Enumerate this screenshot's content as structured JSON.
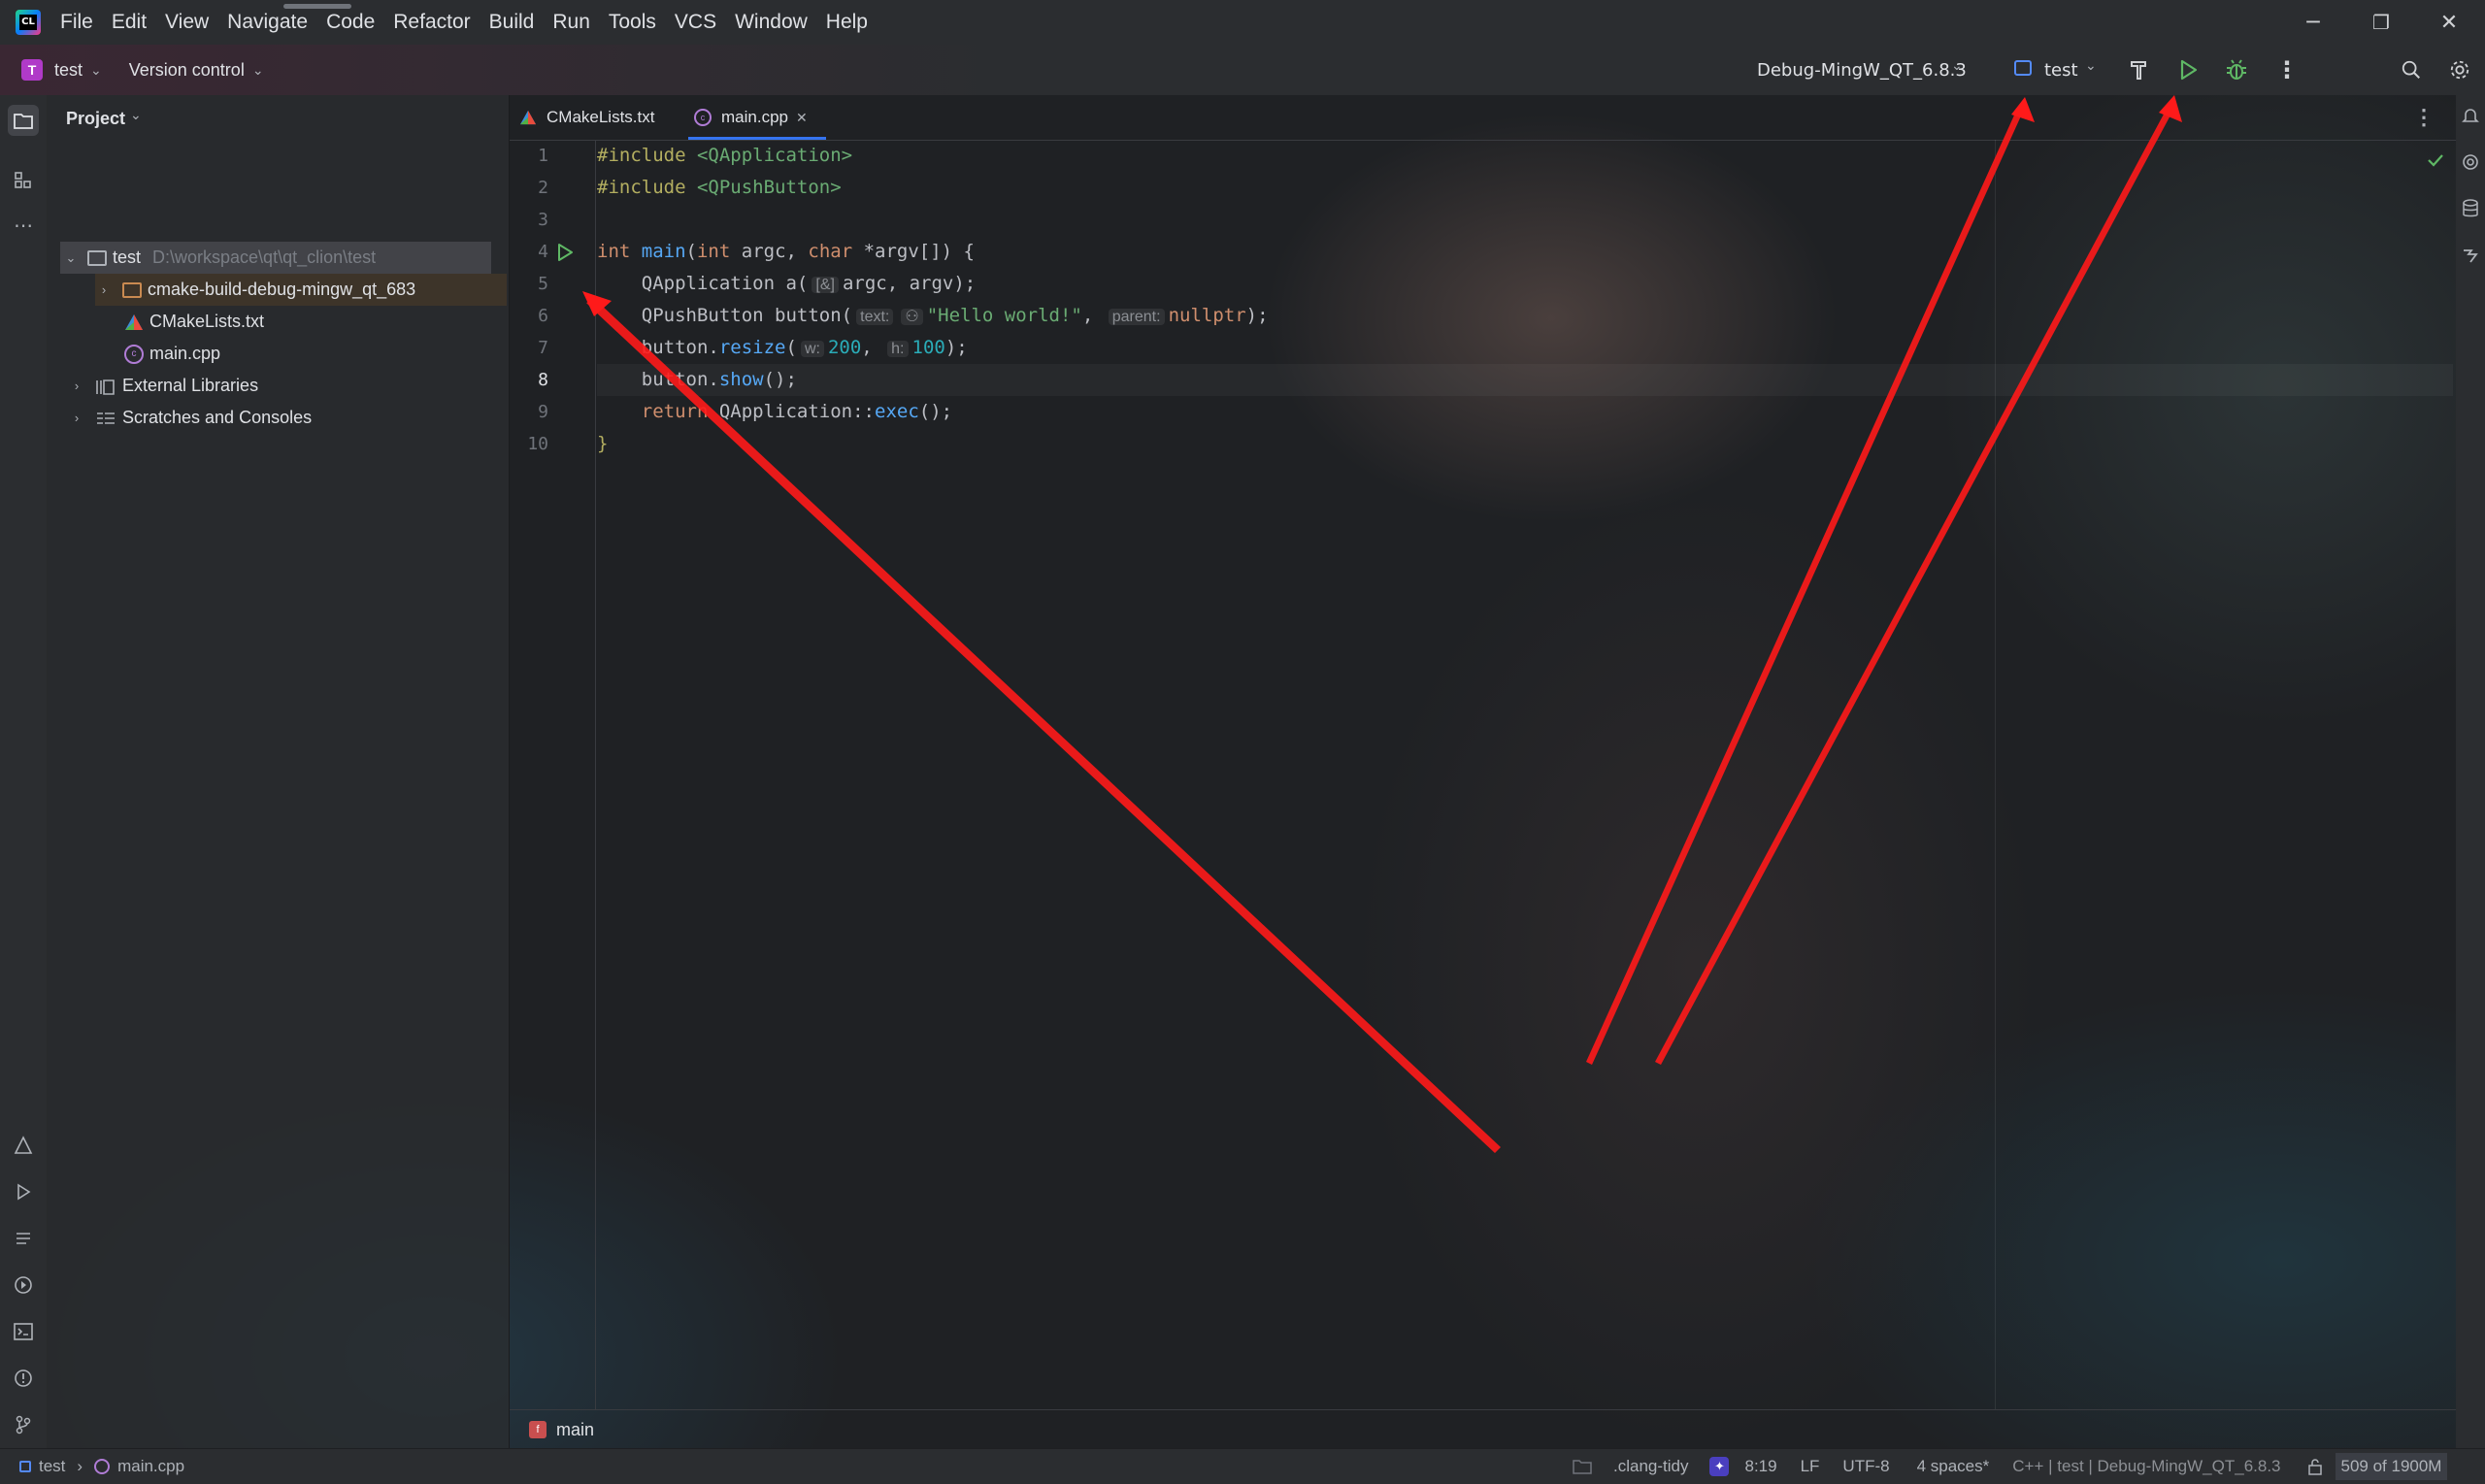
{
  "menubar": {
    "items": [
      "File",
      "Edit",
      "View",
      "Navigate",
      "Code",
      "Refactor",
      "Build",
      "Run",
      "Tools",
      "VCS",
      "Window",
      "Help"
    ]
  },
  "window_controls": {
    "minimize": "─",
    "restore": "❐",
    "close": "✕"
  },
  "toolbar": {
    "project_badge": "T",
    "project_name": "test",
    "vcs_label": "Version control",
    "build_config": "Debug-MingW_QT_6.8.3",
    "run_config": "test",
    "build_icon": "hammer-icon",
    "run_icon": "run-icon",
    "debug_icon": "debug-icon",
    "more_icon": "more-icon",
    "search_icon": "search-icon",
    "settings_icon": "gear-icon"
  },
  "project_panel": {
    "title": "Project",
    "root": {
      "name": "test",
      "path": "D:\\workspace\\qt\\qt_clion\\test"
    },
    "items": [
      {
        "name": "cmake-build-debug-mingw_qt_683"
      },
      {
        "name": "CMakeLists.txt"
      },
      {
        "name": "main.cpp"
      },
      {
        "name": "External Libraries"
      },
      {
        "name": "Scratches and Consoles"
      }
    ]
  },
  "editor": {
    "tabs": [
      {
        "label": "CMakeLists.txt"
      },
      {
        "label": "main.cpp",
        "close": "✕"
      }
    ],
    "line_numbers": [
      "1",
      "2",
      "3",
      "4",
      "5",
      "6",
      "7",
      "8",
      "9",
      "10"
    ],
    "current_line": "8",
    "code": {
      "l1_a": "#include ",
      "l1_b": "<QApplication>",
      "l2_a": "#include ",
      "l2_b": "<QPushButton>",
      "l4_kw": "int ",
      "l4_fn": "main",
      "l4_p1": "(",
      "l4_kw2": "int ",
      "l4_a": "argc, ",
      "l4_kw3": "char ",
      "l4_b": "*argv[]) {",
      "l5_a": "    QApplication ",
      "l5_fn": "a",
      "l5_p": "(",
      "l5_hint": "[&]",
      "l5_b": "argc, argv);",
      "l6_a": "    QPushButton ",
      "l6_fn": "button",
      "l6_p": "(",
      "l6_hint1": "text:",
      "l6_hint2": "⚇",
      "l6_str": "\"Hello world!\"",
      "l6_c": ", ",
      "l6_hint3": "parent:",
      "l6_kw": "nullptr",
      "l6_e": ");",
      "l7_a": "    button.",
      "l7_fn": "resize",
      "l7_p": "(",
      "l7_hint1": "w:",
      "l7_n1": "200",
      "l7_c": ", ",
      "l7_hint2": "h:",
      "l7_n2": "100",
      "l7_e": ");",
      "l8_a": "    button.",
      "l8_fn": "show",
      "l8_e": "();",
      "l9_kw": "    return ",
      "l9_a": "QApplication::",
      "l9_fn": "exec",
      "l9_e": "();",
      "l10": "}"
    },
    "breadcrumb": "main"
  },
  "statusbar": {
    "project": "test",
    "file": "main.cpp",
    "clang_tidy": ".clang-tidy",
    "position": "8:19",
    "line_sep": "LF",
    "encoding": "UTF-8",
    "indent": "4 spaces*",
    "context": "C++ | test | Debug-MingW_QT_6.8.3",
    "memory": "509 of 1900M"
  },
  "colors": {
    "accent": "#3574f0",
    "run_green": "#5fb865",
    "annotation_red": "#ff1a1a"
  }
}
